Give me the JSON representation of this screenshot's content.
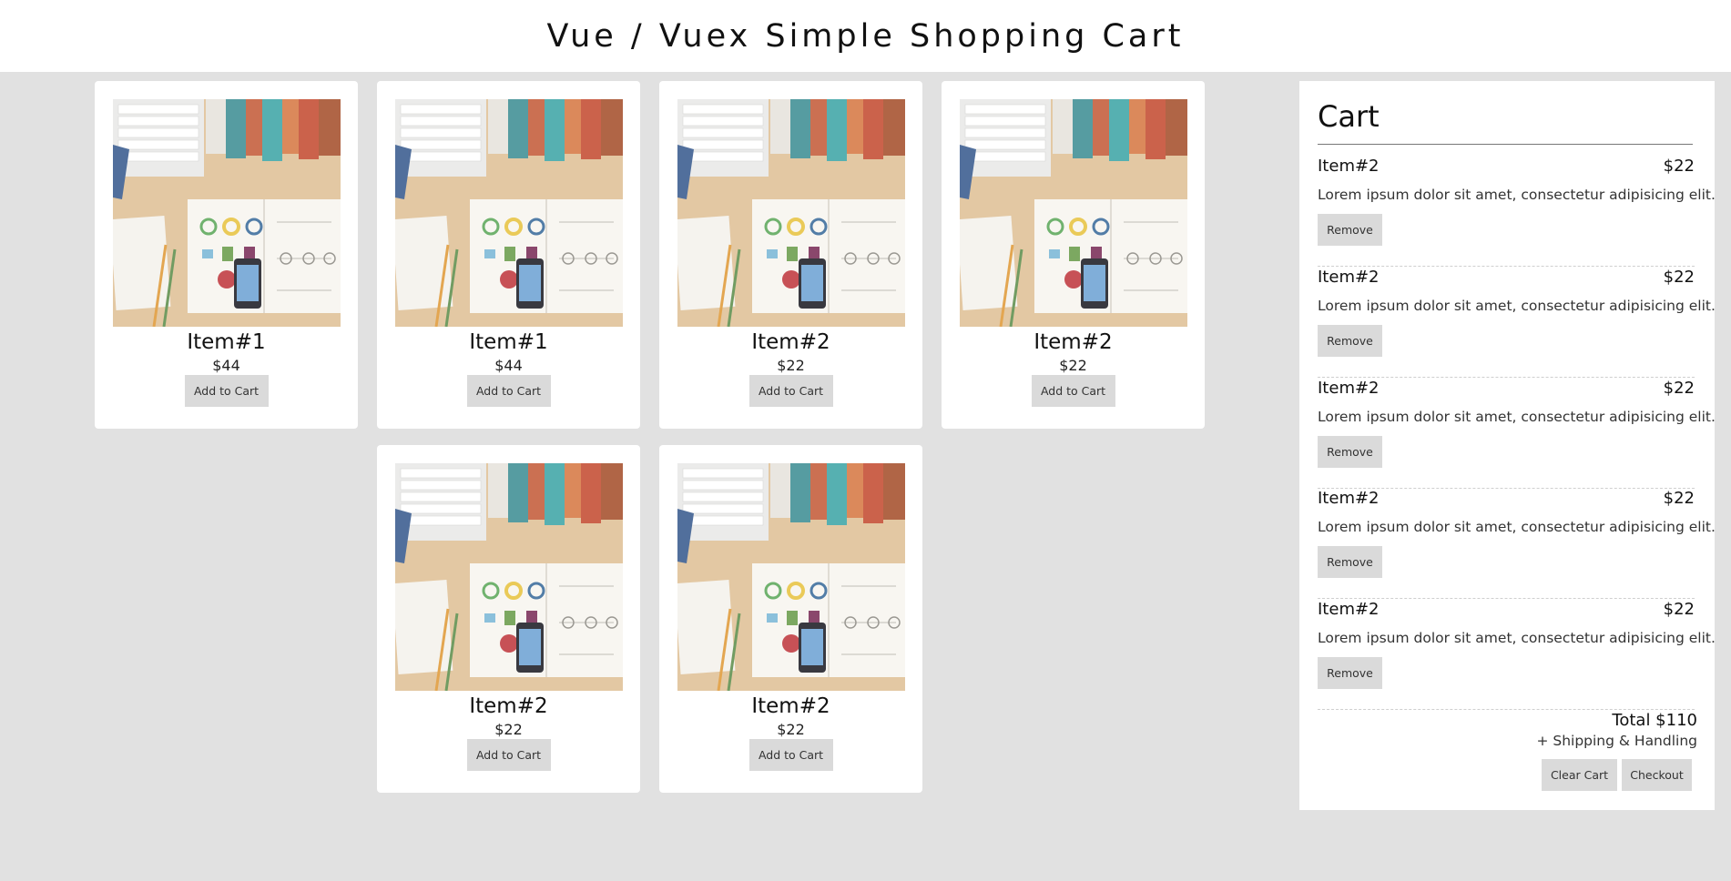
{
  "header": {
    "title": "Vue / Vuex Simple Shopping Cart"
  },
  "products": [
    {
      "name": "Item#1",
      "price": "$44",
      "button": "Add to Cart"
    },
    {
      "name": "Item#1",
      "price": "$44",
      "button": "Add to Cart"
    },
    {
      "name": "Item#2",
      "price": "$22",
      "button": "Add to Cart"
    },
    {
      "name": "Item#2",
      "price": "$22",
      "button": "Add to Cart"
    },
    {
      "name": "Item#2",
      "price": "$22",
      "button": "Add to Cart"
    },
    {
      "name": "Item#2",
      "price": "$22",
      "button": "Add to Cart"
    }
  ],
  "cart": {
    "title": "Cart",
    "items": [
      {
        "name": "Item#2",
        "price": "$22",
        "description": "Lorem ipsum dolor sit amet, consectetur adipisicing elit.",
        "remove_label": "Remove"
      },
      {
        "name": "Item#2",
        "price": "$22",
        "description": "Lorem ipsum dolor sit amet, consectetur adipisicing elit.",
        "remove_label": "Remove"
      },
      {
        "name": "Item#2",
        "price": "$22",
        "description": "Lorem ipsum dolor sit amet, consectetur adipisicing elit.",
        "remove_label": "Remove"
      },
      {
        "name": "Item#2",
        "price": "$22",
        "description": "Lorem ipsum dolor sit amet, consectetur adipisicing elit.",
        "remove_label": "Remove"
      },
      {
        "name": "Item#2",
        "price": "$22",
        "description": "Lorem ipsum dolor sit amet, consectetur adipisicing elit.",
        "remove_label": "Remove"
      }
    ],
    "total": "Total $110",
    "shipping": "+ Shipping & Handling",
    "clear_label": "Clear Cart",
    "checkout_label": "Checkout"
  },
  "colors": {
    "background": "#e1e1e1",
    "card": "#ffffff",
    "button": "#dadada"
  }
}
